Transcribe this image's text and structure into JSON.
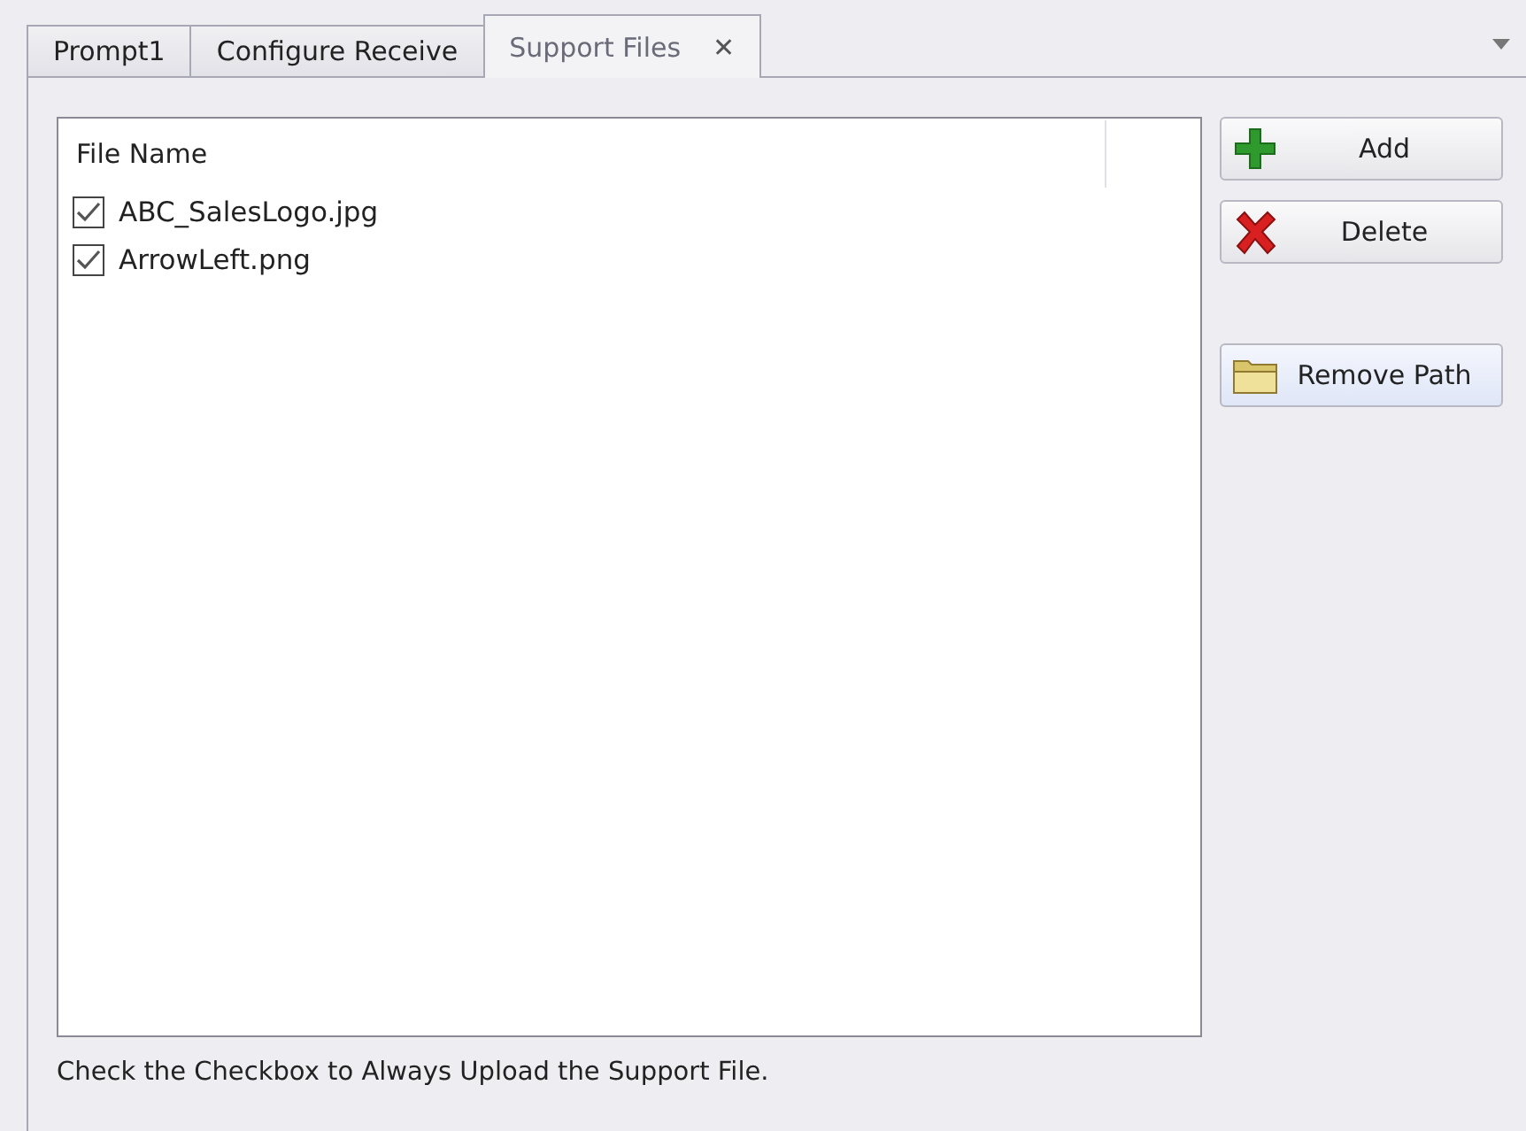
{
  "tabs": [
    {
      "label": "Prompt1",
      "selected": false
    },
    {
      "label": "Configure Receive",
      "selected": false
    },
    {
      "label": "Support Files",
      "selected": true,
      "close": "✕"
    }
  ],
  "file_list": {
    "column": "File Name",
    "rows": [
      {
        "name": "ABC_SalesLogo.jpg",
        "checked": true
      },
      {
        "name": "ArrowLeft.png",
        "checked": true
      }
    ]
  },
  "button_groups": [
    [
      {
        "label": "Add",
        "kind": "add",
        "highlighted": false
      },
      {
        "label": "Delete",
        "kind": "delete",
        "highlighted": false
      }
    ],
    [
      {
        "label": "Remove Path",
        "kind": "folder",
        "highlighted": true
      }
    ]
  ],
  "hint": "Check the Checkbox to Always Upload the Support File."
}
